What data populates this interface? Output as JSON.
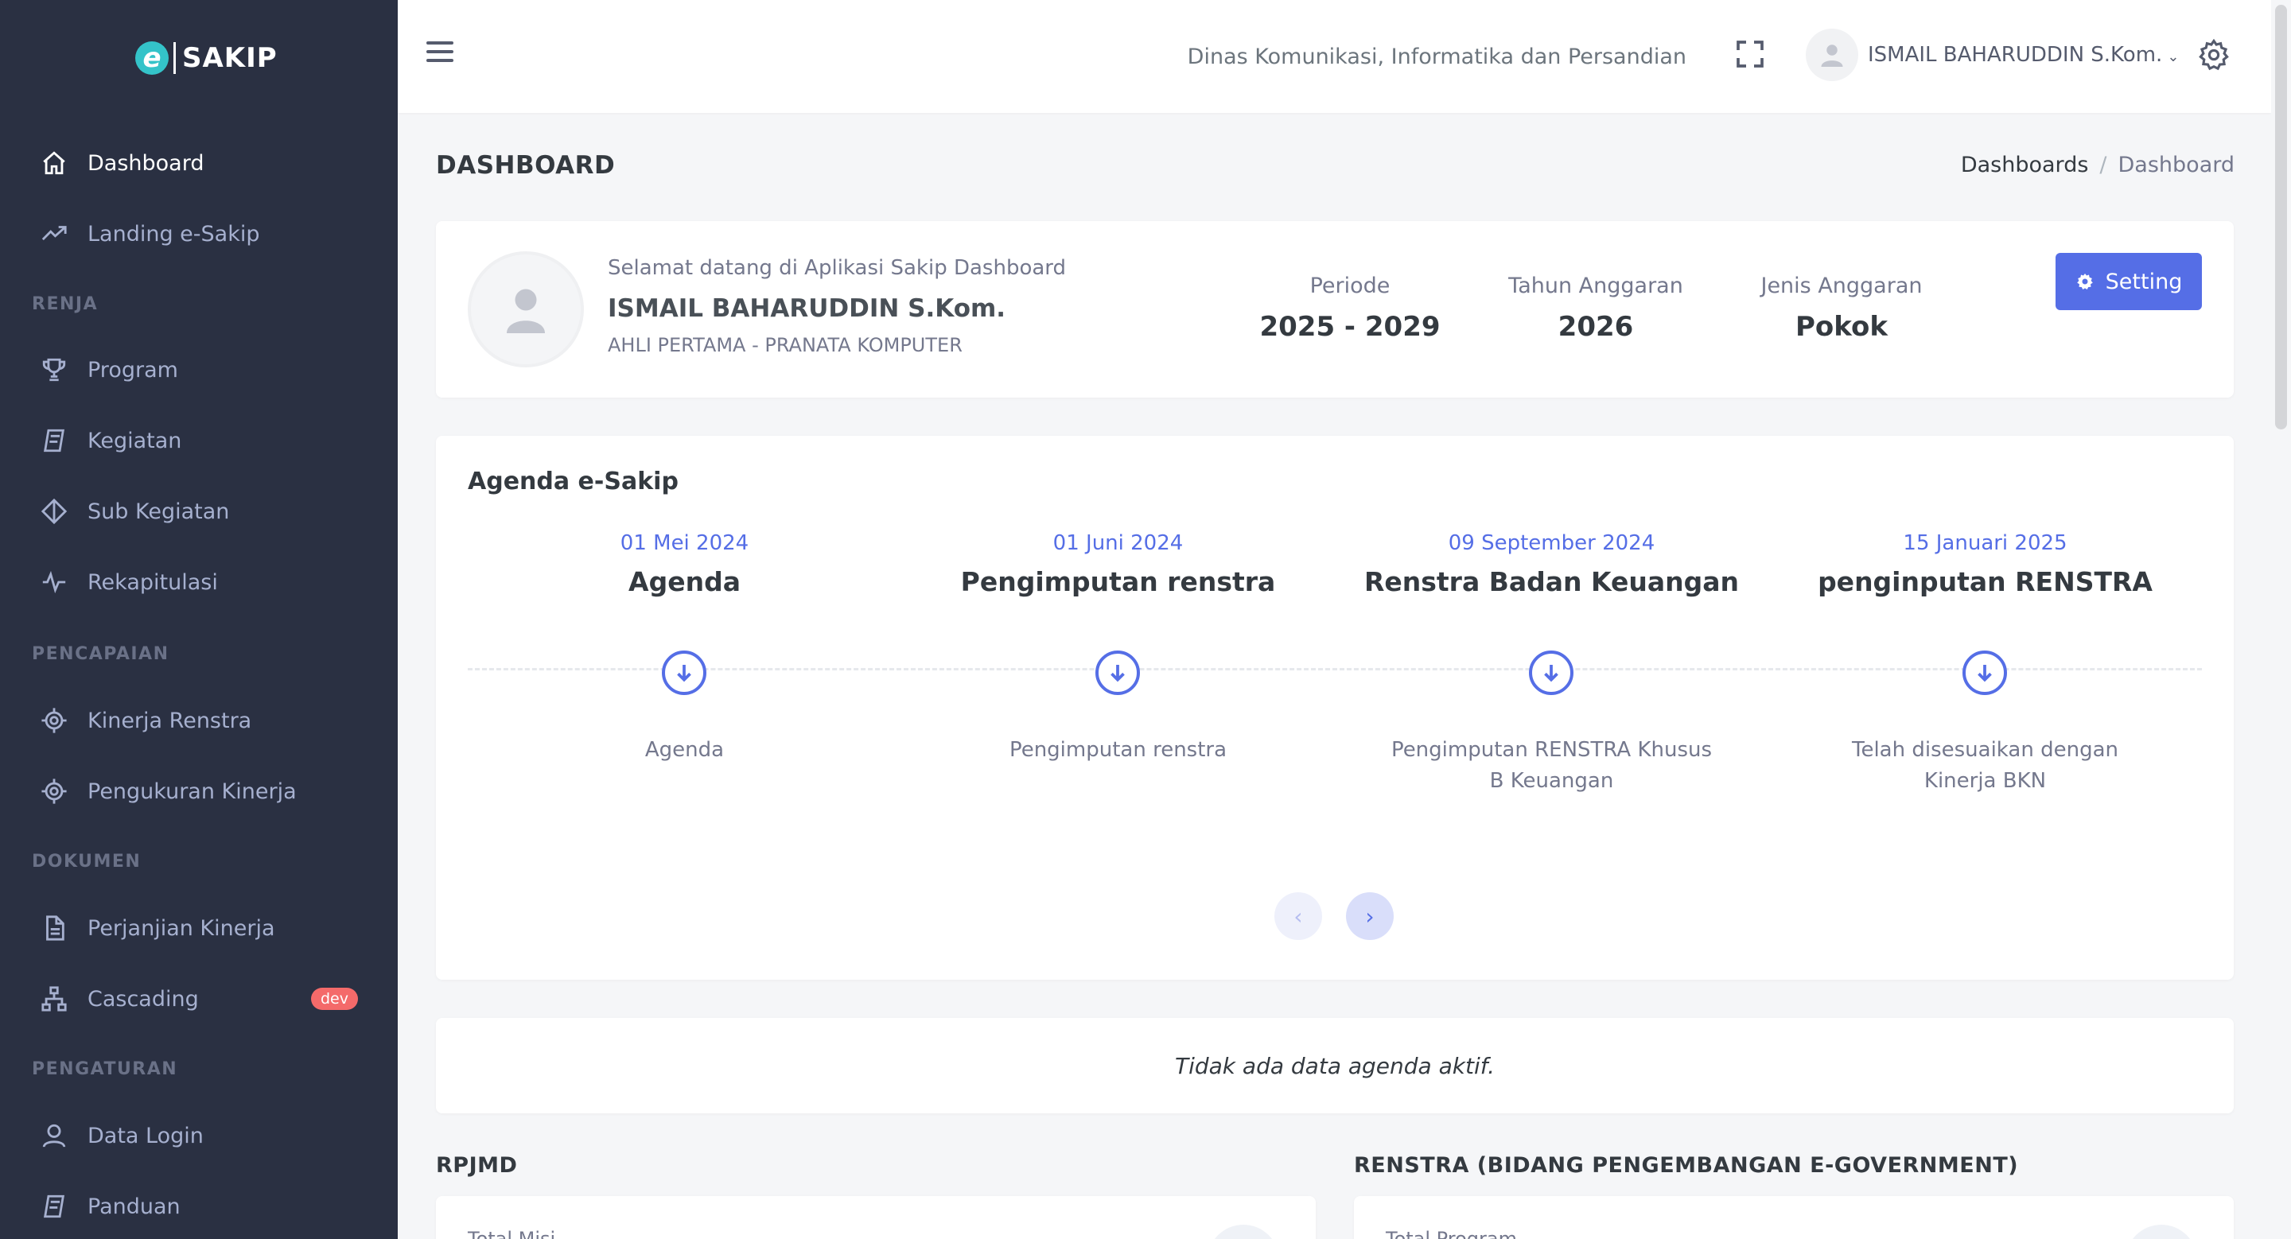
{
  "app": {
    "logo_mark": "e",
    "logo_text": "SAKIP"
  },
  "sidebar": {
    "items": [
      {
        "label": "Dashboard",
        "icon": "home-icon"
      },
      {
        "label": "Landing e-Sakip",
        "icon": "trending-up-icon"
      },
      {
        "label": "Program",
        "icon": "trophy-icon"
      },
      {
        "label": "Kegiatan",
        "icon": "box-icon"
      },
      {
        "label": "Sub Kegiatan",
        "icon": "diamond-icon"
      },
      {
        "label": "Rekapitulasi",
        "icon": "pulse-icon"
      },
      {
        "label": "Kinerja Renstra",
        "icon": "target-icon"
      },
      {
        "label": "Pengukuran Kinerja",
        "icon": "target-icon"
      },
      {
        "label": "Perjanjian Kinerja",
        "icon": "document-icon"
      },
      {
        "label": "Cascading",
        "icon": "sitemap-icon",
        "badge": "dev"
      },
      {
        "label": "Data Login",
        "icon": "user-icon"
      },
      {
        "label": "Panduan",
        "icon": "box-icon"
      }
    ],
    "sections": [
      "RENJA",
      "PENCAPAIAN",
      "DOKUMEN",
      "PENGATURAN"
    ]
  },
  "topbar": {
    "org_name": "Dinas Komunikasi, Informatika dan Persandian",
    "user_name": "ISMAIL BAHARUDDIN S.Kom."
  },
  "page": {
    "title": "DASHBOARD",
    "breadcrumb": [
      "Dashboards",
      "Dashboard"
    ]
  },
  "welcome": {
    "greeting": "Selamat datang di Aplikasi Sakip Dashboard",
    "name": "ISMAIL BAHARUDDIN S.Kom.",
    "role": "AHLI PERTAMA - PRANATA KOMPUTER",
    "stats": [
      {
        "label": "Periode",
        "value": "2025 - 2029"
      },
      {
        "label": "Tahun Anggaran",
        "value": "2026"
      },
      {
        "label": "Jenis Anggaran",
        "value": "Pokok"
      }
    ],
    "setting_label": "Setting"
  },
  "agenda": {
    "title": "Agenda e-Sakip",
    "items": [
      {
        "date": "01 Mei 2024",
        "title": "Agenda",
        "desc": "Agenda"
      },
      {
        "date": "01 Juni 2024",
        "title": "Pengimputan renstra",
        "desc": "Pengimputan renstra"
      },
      {
        "date": "09 September 2024",
        "title": "Renstra Badan Keuangan",
        "desc": "Pengimputan RENSTRA Khusus B Keuangan"
      },
      {
        "date": "15 Januari 2025",
        "title": "penginputan RENSTRA",
        "desc": "Telah disesuaikan dengan Kinerja BKN"
      }
    ],
    "empty_message": "Tidak ada data agenda aktif."
  },
  "sections_bottom": {
    "left_title": "RPJMD",
    "left_card_label": "Total Misi",
    "right_title": "RENSTRA (BIDANG PENGEMBANGAN E-GOVERNMENT)",
    "right_card_label": "Total Program"
  },
  "colors": {
    "sidebar_bg": "#2a3042",
    "accent": "#556ee6",
    "badge_dev": "#f46a6a",
    "logo_mark": "#34c3c9"
  }
}
